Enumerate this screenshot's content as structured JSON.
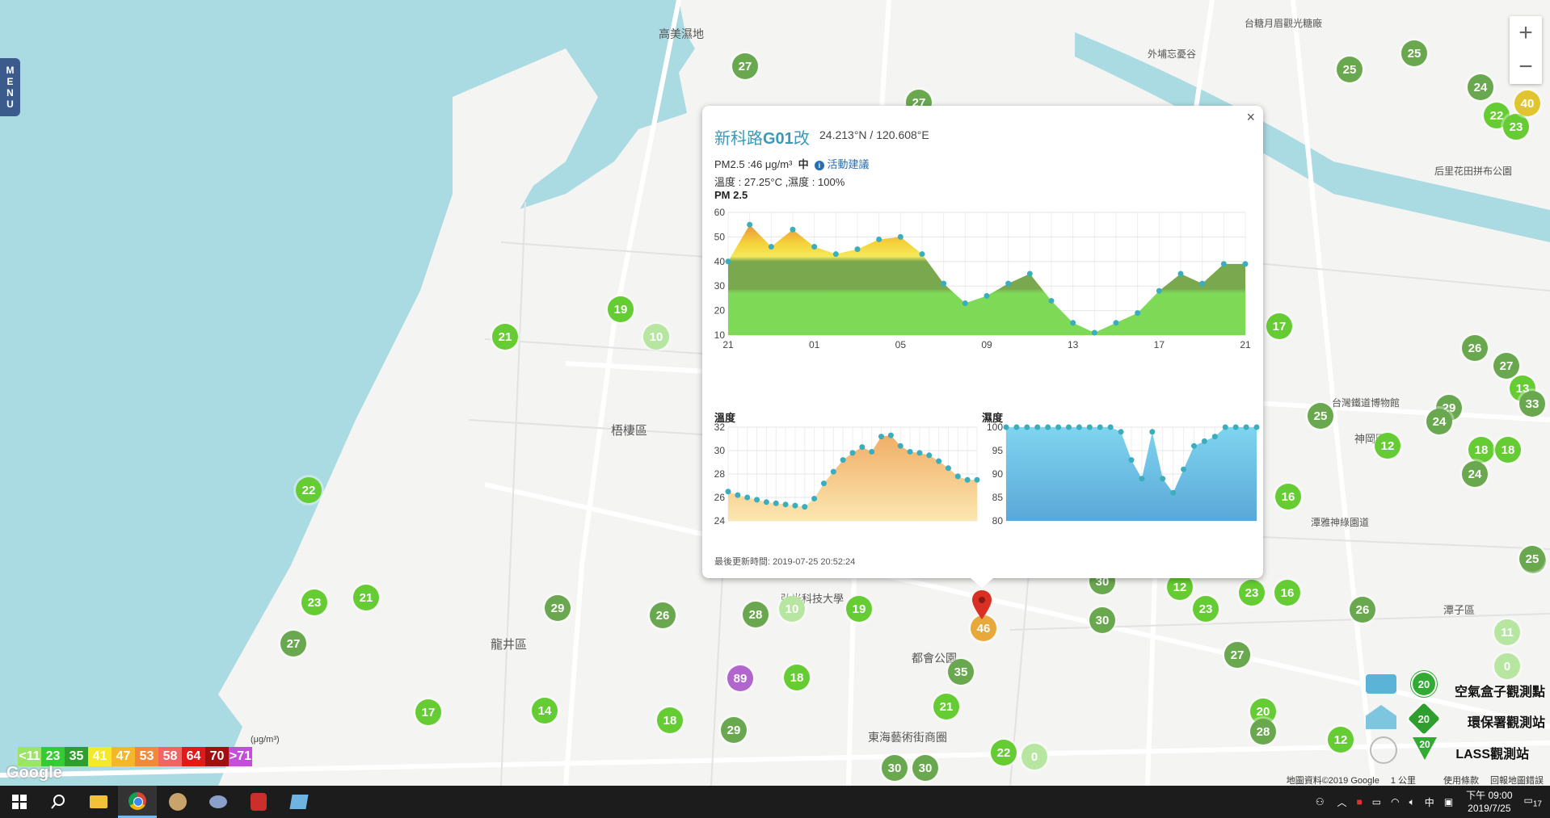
{
  "menu_label": "MENU",
  "map": {
    "labels": [
      {
        "text": "高美濕地"
      },
      {
        "text": "梧棲區"
      },
      {
        "text": "龍井區"
      },
      {
        "text": "都會公園"
      },
      {
        "text": "東海藝術街商圈"
      },
      {
        "text": "弘光科技大學"
      },
      {
        "text": "台糖月眉觀光糖廠"
      },
      {
        "text": "外埔忘憂谷"
      },
      {
        "text": "后里花田拼布公園"
      },
      {
        "text": "台灣鐵道博物館"
      },
      {
        "text": "神岡區"
      },
      {
        "text": "潭雅神綠園道"
      },
      {
        "text": "潭子區"
      }
    ],
    "stations": [
      {
        "v": "27",
        "c": "#6aa84f"
      },
      {
        "v": "27",
        "c": "#6aa84f"
      },
      {
        "v": "19",
        "c": "#66cc33"
      },
      {
        "v": "10",
        "c": "#b6e6a0"
      },
      {
        "v": "21",
        "c": "#66cc33"
      },
      {
        "v": "22",
        "c": "#66cc33"
      },
      {
        "v": "23",
        "c": "#66cc33"
      },
      {
        "v": "21",
        "c": "#66cc33"
      },
      {
        "v": "27",
        "c": "#6aa84f"
      },
      {
        "v": "29",
        "c": "#6aa84f"
      },
      {
        "v": "26",
        "c": "#6aa84f"
      },
      {
        "v": "28",
        "c": "#6aa84f"
      },
      {
        "v": "10",
        "c": "#b6e6a0"
      },
      {
        "v": "19",
        "c": "#66cc33"
      },
      {
        "v": "89",
        "c": "#b066cc"
      },
      {
        "v": "18",
        "c": "#66cc33"
      },
      {
        "v": "35",
        "c": "#6aa84f"
      },
      {
        "v": "21",
        "c": "#66cc33"
      },
      {
        "v": "17",
        "c": "#66cc33"
      },
      {
        "v": "14",
        "c": "#66cc33"
      },
      {
        "v": "18",
        "c": "#66cc33"
      },
      {
        "v": "29",
        "c": "#6aa84f"
      },
      {
        "v": "30",
        "c": "#6aa84f"
      },
      {
        "v": "30",
        "c": "#6aa84f"
      },
      {
        "v": "22",
        "c": "#66cc33"
      },
      {
        "v": "0",
        "c": "#b6e6a0"
      },
      {
        "v": "30",
        "c": "#6aa84f"
      },
      {
        "v": "30",
        "c": "#6aa84f"
      },
      {
        "v": "12",
        "c": "#66cc33"
      },
      {
        "v": "23",
        "c": "#66cc33"
      },
      {
        "v": "23",
        "c": "#66cc33"
      },
      {
        "v": "16",
        "c": "#66cc33"
      },
      {
        "v": "26",
        "c": "#6aa84f"
      },
      {
        "v": "27",
        "c": "#6aa84f"
      },
      {
        "v": "25",
        "c": "#6aa84f"
      },
      {
        "v": "25",
        "c": "#6aa84f"
      },
      {
        "v": "24",
        "c": "#6aa84f"
      },
      {
        "v": "22",
        "c": "#66cc33"
      },
      {
        "v": "23",
        "c": "#66cc33"
      },
      {
        "v": "40",
        "c": "#e0c530"
      },
      {
        "v": "17",
        "c": "#66cc33"
      },
      {
        "v": "26",
        "c": "#6aa84f"
      },
      {
        "v": "27",
        "c": "#6aa84f"
      },
      {
        "v": "25",
        "c": "#6aa84f"
      },
      {
        "v": "12",
        "c": "#66cc33"
      },
      {
        "v": "29",
        "c": "#6aa84f"
      },
      {
        "v": "24",
        "c": "#6aa84f"
      },
      {
        "v": "18",
        "c": "#66cc33"
      },
      {
        "v": "18",
        "c": "#66cc33"
      },
      {
        "v": "24",
        "c": "#6aa84f"
      },
      {
        "v": "16",
        "c": "#66cc33"
      },
      {
        "v": "26",
        "c": "#6aa84f"
      },
      {
        "v": "25",
        "c": "#6aa84f"
      },
      {
        "v": "11",
        "c": "#b6e6a0"
      },
      {
        "v": "0",
        "c": "#b6e6a0"
      },
      {
        "v": "20",
        "c": "#66cc33"
      },
      {
        "v": "28",
        "c": "#6aa84f"
      },
      {
        "v": "12",
        "c": "#66cc33"
      },
      {
        "v": "13",
        "c": "#66cc33"
      },
      {
        "v": "33",
        "c": "#6aa84f"
      },
      {
        "v": "27",
        "c": "#6aa84f"
      },
      {
        "v": "46",
        "c": "#e8a83a"
      }
    ]
  },
  "popup": {
    "title_prefix": "新科路",
    "title_bold": "G01",
    "title_suffix": "改",
    "coords": "24.213°N / 120.608°E",
    "pm_text": "PM2.5 :46 μg/m³",
    "pm_level": "中",
    "advice": "活動建議",
    "temp_humidity_text": "溫度 : 27.25°C ,濕度 : 100%",
    "pm_chart_title": "PM 2.5",
    "temp_chart_title": "溫度",
    "hum_chart_title": "濕度",
    "close": "×",
    "updated": "最後更新時間: 2019-07-25 20:52:24"
  },
  "chart_data": [
    {
      "type": "area",
      "title": "PM 2.5",
      "x_ticks": [
        "21",
        "01",
        "05",
        "09",
        "13",
        "17",
        "21"
      ],
      "ylim": [
        10,
        60
      ],
      "y_ticks": [
        10,
        20,
        30,
        40,
        50,
        60
      ],
      "values": [
        40,
        55,
        46,
        53,
        46,
        43,
        45,
        49,
        50,
        43,
        31,
        23,
        26,
        31,
        35,
        24,
        15,
        11,
        15,
        19,
        28,
        35,
        31,
        39,
        39
      ],
      "grid": true
    },
    {
      "type": "area",
      "title": "溫度",
      "ylim": [
        24,
        32
      ],
      "y_ticks": [
        24,
        26,
        28,
        30,
        32
      ],
      "values": [
        26.5,
        26.2,
        26.0,
        25.8,
        25.6,
        25.5,
        25.4,
        25.3,
        25.2,
        25.9,
        27.2,
        28.2,
        29.2,
        29.8,
        30.3,
        29.9,
        31.2,
        31.3,
        30.4,
        29.9,
        29.8,
        29.6,
        29.1,
        28.5,
        27.8,
        27.5,
        27.5
      ],
      "grid": true
    },
    {
      "type": "area",
      "title": "濕度",
      "ylim": [
        80,
        100
      ],
      "y_ticks": [
        80,
        85,
        90,
        95,
        100
      ],
      "values": [
        100,
        100,
        100,
        100,
        100,
        100,
        100,
        100,
        100,
        100,
        100,
        99,
        93,
        89,
        99,
        89,
        86,
        91,
        96,
        97,
        98,
        100,
        100,
        100,
        100
      ],
      "grid": true
    }
  ],
  "legend": {
    "unit": "(μg/m³)",
    "items": [
      {
        "text": "<11",
        "color": "#9be564"
      },
      {
        "text": "23",
        "color": "#33cc33"
      },
      {
        "text": "35",
        "color": "#2e9e2e"
      },
      {
        "text": "41",
        "color": "#f5e82a"
      },
      {
        "text": "47",
        "color": "#f5b72a"
      },
      {
        "text": "53",
        "color": "#f08a3a"
      },
      {
        "text": "58",
        "color": "#f06464"
      },
      {
        "text": "64",
        "color": "#e01a1a"
      },
      {
        "text": "70",
        "color": "#a01010"
      },
      {
        "text": ">71",
        "color": "#c44dd9"
      }
    ]
  },
  "station_legend": [
    {
      "label": "空氣盒子觀測點",
      "value": "20"
    },
    {
      "label": "環保署觀測站",
      "value": "20"
    },
    {
      "label": "LASS觀測站",
      "value": "20"
    }
  ],
  "google": "Google",
  "attribution": {
    "map_data": "地圖資料©2019 Google",
    "scale": "1 公里",
    "terms": "使用條款",
    "report": "回報地圖錯誤"
  },
  "taskbar": {
    "time": "下午 09:00",
    "date": "2019/7/25",
    "ime": "中",
    "notifications": "17"
  }
}
